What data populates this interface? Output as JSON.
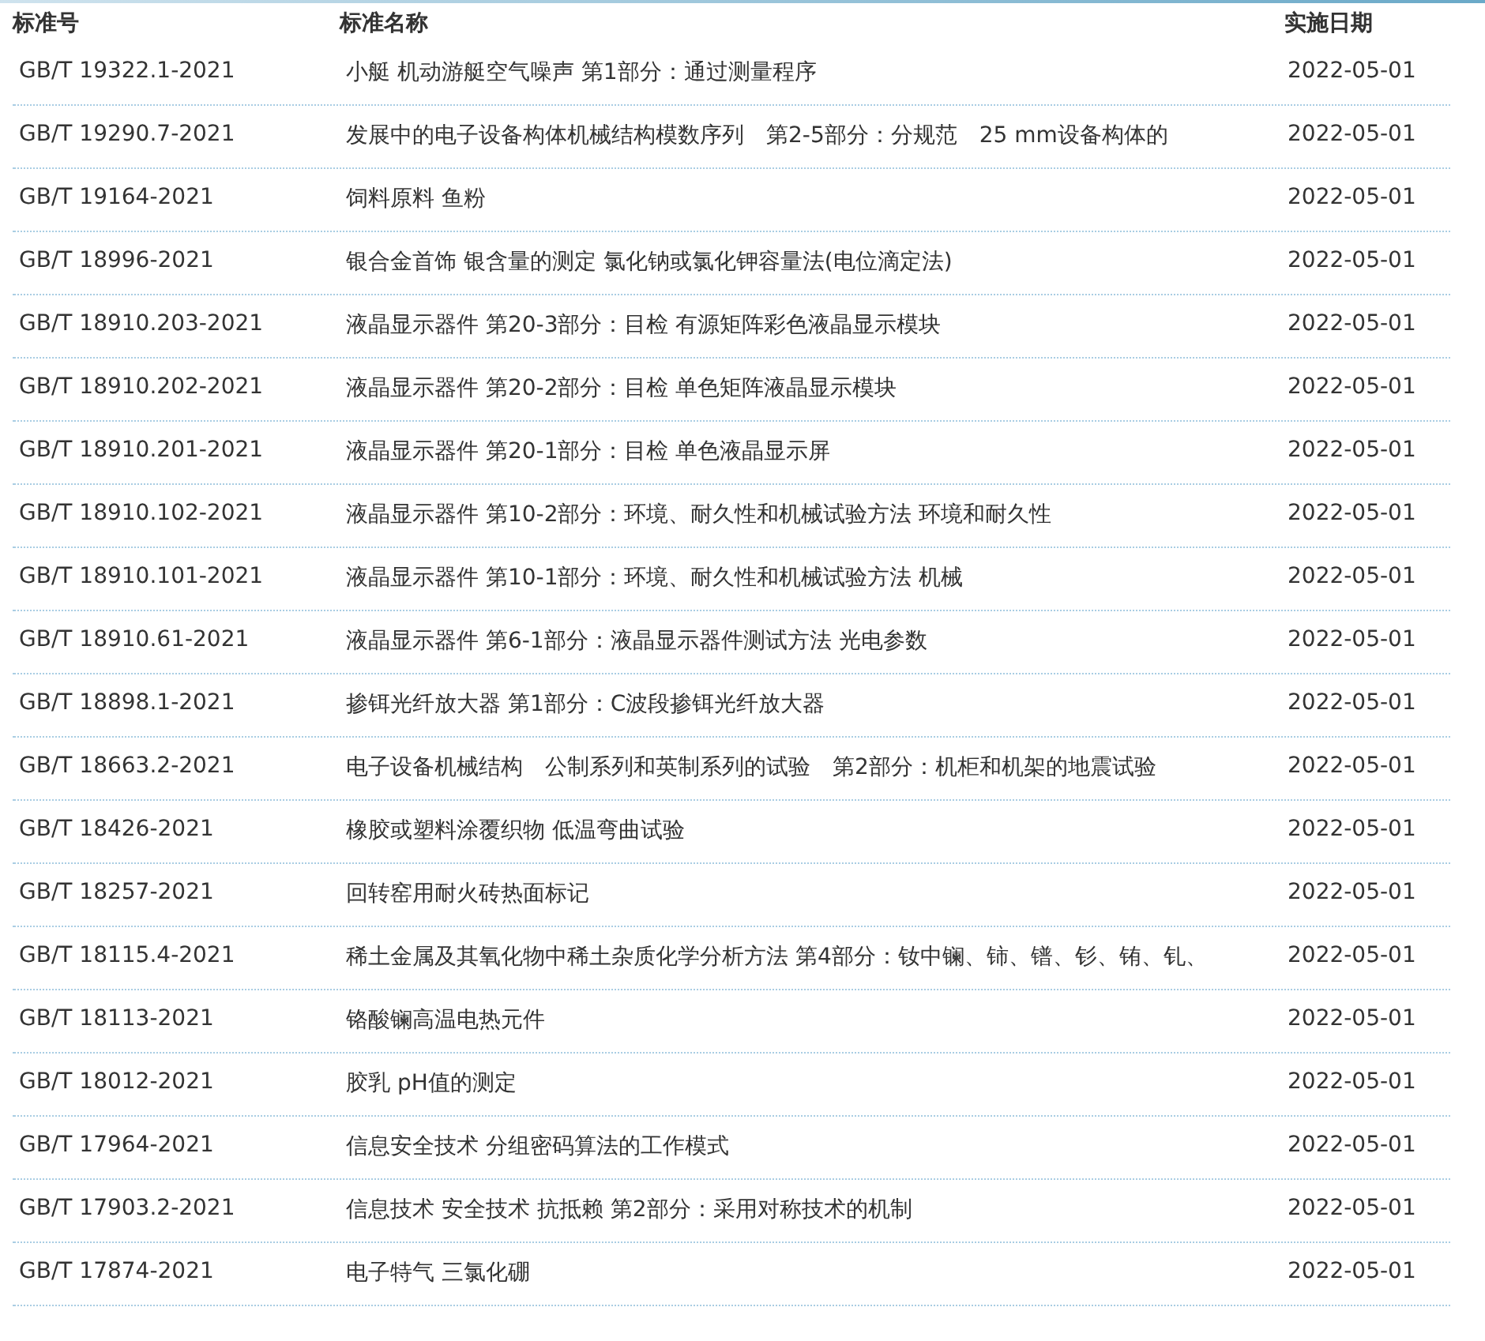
{
  "table": {
    "columns": [
      "标准号",
      "标准名称",
      "实施日期"
    ],
    "rows": [
      [
        "GB/T 19322.1-2021",
        "小艇 机动游艇空气噪声 第1部分：通过测量程序",
        "2022-05-01"
      ],
      [
        "GB/T 19290.7-2021",
        "发展中的电子设备构体机械结构模数序列　第2-5部分：分规范　25 mm设备构体的",
        "2022-05-01"
      ],
      [
        "GB/T 19164-2021",
        "饲料原料 鱼粉",
        "2022-05-01"
      ],
      [
        "GB/T 18996-2021",
        "银合金首饰 银含量的测定 氯化钠或氯化钾容量法(电位滴定法)",
        "2022-05-01"
      ],
      [
        "GB/T 18910.203-2021",
        "液晶显示器件 第20-3部分：目检 有源矩阵彩色液晶显示模块",
        "2022-05-01"
      ],
      [
        "GB/T 18910.202-2021",
        "液晶显示器件 第20-2部分：目检 单色矩阵液晶显示模块",
        "2022-05-01"
      ],
      [
        "GB/T 18910.201-2021",
        "液晶显示器件 第20-1部分：目检 单色液晶显示屏",
        "2022-05-01"
      ],
      [
        "GB/T 18910.102-2021",
        "液晶显示器件 第10-2部分：环境、耐久性和机械试验方法 环境和耐久性",
        "2022-05-01"
      ],
      [
        "GB/T 18910.101-2021",
        "液晶显示器件 第10-1部分：环境、耐久性和机械试验方法 机械",
        "2022-05-01"
      ],
      [
        "GB/T 18910.61-2021",
        "液晶显示器件 第6-1部分：液晶显示器件测试方法 光电参数",
        "2022-05-01"
      ],
      [
        "GB/T 18898.1-2021",
        "掺铒光纤放大器 第1部分：C波段掺铒光纤放大器",
        "2022-05-01"
      ],
      [
        "GB/T 18663.2-2021",
        "电子设备机械结构　公制系列和英制系列的试验　第2部分：机柜和机架的地震试验",
        "2022-05-01"
      ],
      [
        "GB/T 18426-2021",
        "橡胶或塑料涂覆织物 低温弯曲试验",
        "2022-05-01"
      ],
      [
        "GB/T 18257-2021",
        "回转窑用耐火砖热面标记",
        "2022-05-01"
      ],
      [
        "GB/T 18115.4-2021",
        "稀土金属及其氧化物中稀土杂质化学分析方法 第4部分：钕中镧、铈、镨、钐、铕、钆、",
        "2022-05-01"
      ],
      [
        "GB/T 18113-2021",
        "铬酸镧高温电热元件",
        "2022-05-01"
      ],
      [
        "GB/T 18012-2021",
        "胶乳 pH值的测定",
        "2022-05-01"
      ],
      [
        "GB/T 17964-2021",
        "信息安全技术 分组密码算法的工作模式",
        "2022-05-01"
      ],
      [
        "GB/T 17903.2-2021",
        "信息技术 安全技术 抗抵赖 第2部分：采用对称技术的机制",
        "2022-05-01"
      ],
      [
        "GB/T 17874-2021",
        "电子特气 三氯化硼",
        "2022-05-01"
      ]
    ]
  }
}
